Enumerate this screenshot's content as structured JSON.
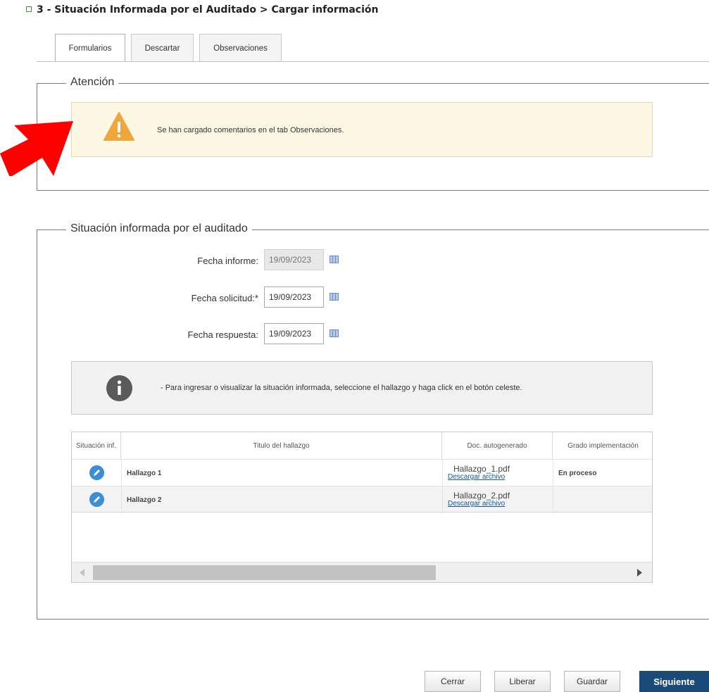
{
  "header": {
    "title": "3 - Situación Informada por el Auditado  > Cargar información"
  },
  "tabs": [
    {
      "label": "Formularios"
    },
    {
      "label": "Descartar"
    },
    {
      "label": "Observaciones"
    }
  ],
  "attention": {
    "legend": "Atención",
    "message": "Se han cargado comentarios en el tab Observaciones."
  },
  "situacion": {
    "legend": "Situación informada por el auditado",
    "fecha_informe": {
      "label": "Fecha informe:",
      "value": "19/09/2023"
    },
    "fecha_solicitud": {
      "label": "Fecha solicitud:*",
      "value": "19/09/2023"
    },
    "fecha_respuesta": {
      "label": "Fecha respuesta:",
      "value": "19/09/2023"
    },
    "info_message": "- Para ingresar o visualizar la situación informada, seleccione el hallazgo y haga click en el botón celeste."
  },
  "table": {
    "columns": [
      "Situación inf.",
      "Titulo del hallazgo",
      "Doc. autogenerado",
      "Grado implementación"
    ],
    "rows": [
      {
        "titulo": "Hallazgo 1",
        "doc": "Hallazgo_1.pdf",
        "link": "Descargar archivo",
        "grado": "En proceso"
      },
      {
        "titulo": "Hallazgo 2",
        "doc": "Hallazgo_2.pdf",
        "link": "Descargar archivo",
        "grado": ""
      }
    ]
  },
  "buttons": {
    "cerrar": "Cerrar",
    "liberar": "Liberar",
    "guardar": "Guardar",
    "siguiente": "Siguiente"
  },
  "colors": {
    "annotation_arrow": "#ff0000",
    "primary_button": "#1a4b78",
    "warning_bg": "#fcf8e3",
    "warning_icon": "#f0a63a",
    "edit_icon": "#3d8fd4"
  },
  "icons": {
    "warning": "warning-triangle-icon",
    "info": "info-circle-icon",
    "edit": "pencil-icon",
    "calendar": "calendar-icon"
  }
}
